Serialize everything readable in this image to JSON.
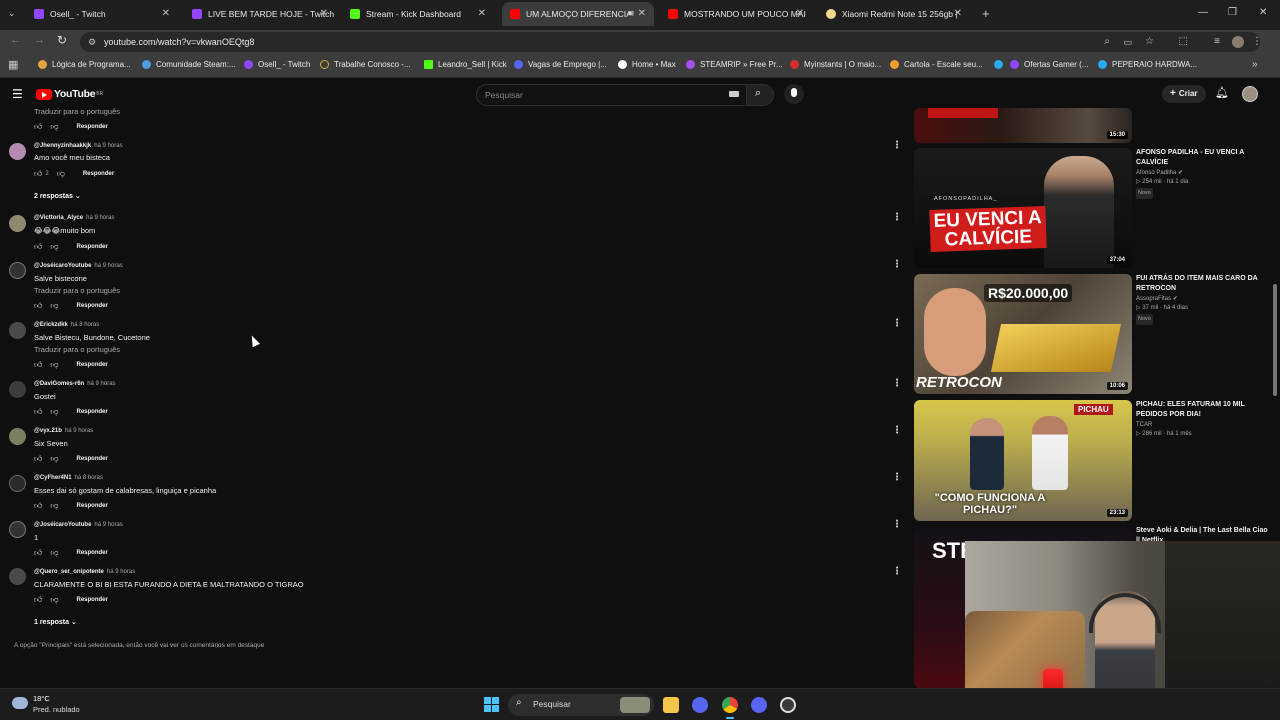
{
  "browser": {
    "tabs": [
      {
        "label": "Osell_ - Twitch",
        "color": "#9146ff"
      },
      {
        "label": "LIVE BEM TARDE HOJE - Twitch",
        "color": "#9146ff"
      },
      {
        "label": "Stream - Kick Dashboard",
        "color": "#53fc18"
      },
      {
        "label": "UM ALMOÇO DIFERENCIAD",
        "color": "#ff0000"
      },
      {
        "label": "MOSTRANDO UM POUCO MAI",
        "color": "#ff0000"
      },
      {
        "label": "Xiaomi Redmi Note 15 256gb |",
        "color": "#f5d98b"
      }
    ],
    "url": "youtube.com/watch?v=vkwanOEQtg8",
    "bookmarks": [
      {
        "label": "Lógica de Programa...",
        "color": "#e8a33d"
      },
      {
        "label": "Comunidade Steam:...",
        "color": "#4f9de0"
      },
      {
        "label": "Osell_ - Twitch",
        "color": "#9146ff"
      },
      {
        "label": "Trabalhe Conosco -...",
        "color": "#c9b53a"
      },
      {
        "label": "Leandro_Sell | Kick",
        "color": "#53fc18"
      },
      {
        "label": "Vagas de Emprego |...",
        "color": "#5865f2"
      },
      {
        "label": "Home • Max",
        "color": "#ffffff"
      },
      {
        "label": "STEAMRIP » Free Pr...",
        "color": "#a64df5"
      },
      {
        "label": "Myinstants | O maio...",
        "color": "#d32f2f"
      },
      {
        "label": "Cartola - Escale seu...",
        "color": "#f0a030"
      },
      {
        "label": "",
        "color": "#2aabee"
      },
      {
        "label": "Ofertas Gamer (...",
        "color": "#9146ff"
      },
      {
        "label": "PEPERAIO HARDWA...",
        "color": "#2aabee"
      }
    ]
  },
  "youtube": {
    "logo": "YouTube",
    "region": "BR",
    "search_placeholder": "Pesquisar",
    "create_label": "Criar"
  },
  "comments": {
    "first_translate": "Traduzir para o português",
    "reply_label": "Responder",
    "items": [
      {
        "handle": "@Jhennyzinhaakkjk",
        "time": "há 9 horas",
        "text": "Amo você meu bisteca",
        "likes": "2",
        "translate": ""
      },
      {
        "handle": "@Victtoria_Alyce",
        "time": "há 9 horas",
        "text": "😂😂😂muito bom",
        "likes": "",
        "translate": ""
      },
      {
        "handle": "@JoséicaroYoutube",
        "time": "há 9 horas",
        "text": "Salve bistecone",
        "likes": "",
        "translate": "Traduzir para o português"
      },
      {
        "handle": "@Erickzdkk",
        "time": "há 8 horas",
        "text": "Salve Bistecu, Bundone, Cucetone",
        "likes": "",
        "translate": "Traduzir para o português"
      },
      {
        "handle": "@DaviGomes-r6n",
        "time": "há 9 horas",
        "text": "Gostei",
        "likes": "",
        "translate": ""
      },
      {
        "handle": "@vyx.21b",
        "time": "há 9 horas",
        "text": "Six Seven",
        "likes": "",
        "translate": ""
      },
      {
        "handle": "@CyFher4N1",
        "time": "há 8 horas",
        "text": "Esses dai só gostam de calabresas, linguiça e picanha",
        "likes": "",
        "translate": ""
      },
      {
        "handle": "@JoséicaroYoutube",
        "time": "há 9 horas",
        "text": "1",
        "likes": "",
        "translate": ""
      },
      {
        "handle": "@Quero_ser_onipotente",
        "time": "há 9 horas",
        "text": "CLARAMENTE O BI BI ESTA FURANDO A DIETA E MALTRATANDO O TIGRAO",
        "likes": "",
        "translate": ""
      }
    ],
    "replies_1": "2 respostas",
    "replies_2": "1 resposta",
    "footer": "A opção \"Principais\" está selecionada, então você vai ver os comentários em destaque"
  },
  "sidebar": {
    "videos": [
      {
        "title": "",
        "channel": "",
        "views": "",
        "badge": "",
        "duration": "15:30",
        "thumb_text": ""
      },
      {
        "title": "AFONSO PADILHA - EU VENCI A CALVÍCIE",
        "channel": "Afonso Padilha",
        "views": "254 mil · há 1 dia",
        "badge": "Novo",
        "duration": "37:04",
        "thumb_text": "EU VENCI A CALVÍCIE",
        "thumb_top": "AFONSOPADILHA_"
      },
      {
        "title": "FUI ATRÁS DO ITEM MAIS CARO DA RETROCON",
        "channel": "AssopraFitas",
        "views": "37 mil · há 4 dias",
        "badge": "Novo",
        "duration": "10:06",
        "thumb_text": "R$20.000,00",
        "thumb_bottom": "RETROCON"
      },
      {
        "title": "PICHAU: ELES FATURAM 10 MIL PEDIDOS POR DIA!",
        "channel": "TCAR",
        "views": "286 mil · há 1 mês",
        "badge": "",
        "duration": "23:13",
        "thumb_text": "\"COMO FUNCIONA A PICHAU?\"",
        "thumb_top": "PICHAU"
      },
      {
        "title": "Steve Aoki & Delia | The Last Bella Ciao || Netflix",
        "channel": "",
        "views": "",
        "badge": "",
        "duration": "",
        "thumb_text": "STE"
      }
    ]
  },
  "taskbar": {
    "weather_temp": "18°C",
    "weather_desc": "Pred. nublado",
    "search": "Pesquisar"
  }
}
